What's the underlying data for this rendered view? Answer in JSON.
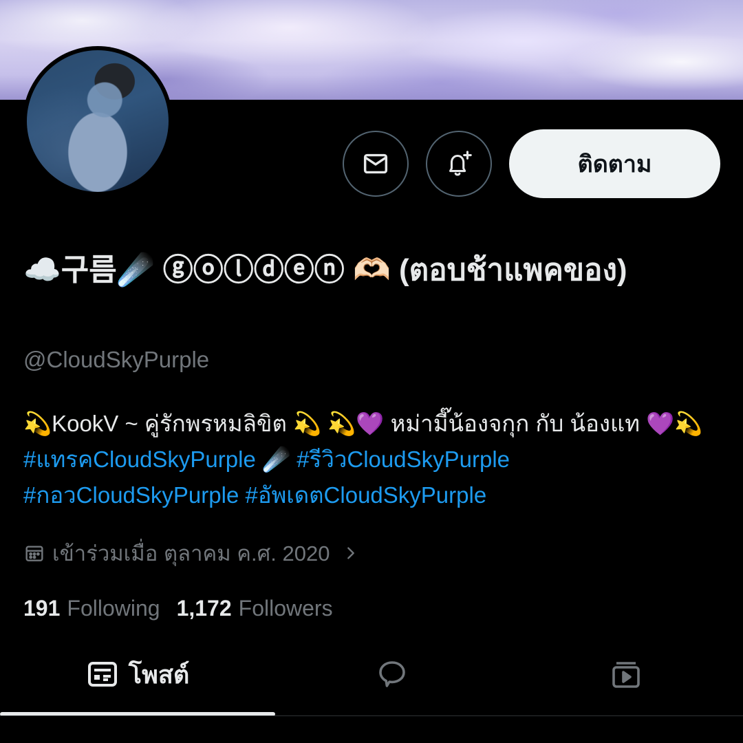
{
  "profile": {
    "display_name": "☁️구름☄️ ⓖⓞⓛⓓⓔⓝ 🫶🏻 (ตอบช้าแพคของ)",
    "handle": "@CloudSkyPurple",
    "bio_text": "💫KookV ~ คู่รักพรหมลิขิต 💫 💫💜 หม่ามี๊น้องจกุก กับ น้องแท 💜💫 ",
    "bio_tags": [
      "#แทรคCloudSkyPurple",
      "☄️",
      "#รีวิวCloudSkyPurple",
      "#กอวCloudSkyPurple",
      "#อัพเดตCloudSkyPurple"
    ],
    "joined": "เข้าร่วมเมื่อ ตุลาคม ค.ศ. 2020",
    "following_count": "191",
    "following_label": "Following",
    "followers_count": "1,172",
    "followers_label": "Followers"
  },
  "actions": {
    "follow_label": "ติดตาม"
  },
  "tabs": {
    "posts_label": "โพสต์"
  },
  "icons": {
    "message": "envelope-icon",
    "notify": "bell-plus-icon",
    "calendar": "calendar-icon",
    "chevron": "chevron-right-icon",
    "posts": "posts-list-icon",
    "replies": "speech-bubble-icon",
    "media": "media-play-icon"
  },
  "colors": {
    "background": "#000000",
    "text": "#e7e9ea",
    "secondary": "#71767b",
    "link": "#1d9bf0",
    "follow_button": "#eff3f4"
  }
}
